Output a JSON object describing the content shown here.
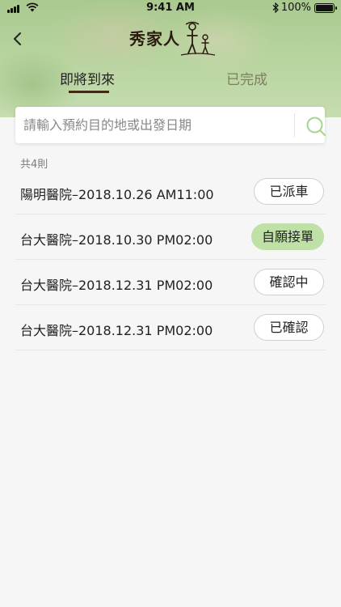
{
  "status_bar": {
    "time": "9:41 AM",
    "battery": "100%"
  },
  "header": {
    "logo_text": "秀家人",
    "back_icon": "chevron-left-icon"
  },
  "tabs": [
    {
      "label": "即將到來",
      "active": true
    },
    {
      "label": "已完成",
      "active": false
    }
  ],
  "search": {
    "placeholder": "請輸入預約目的地或出發日期",
    "value": "",
    "icon": "search-icon"
  },
  "count_label": "共4則",
  "rows": [
    {
      "text": "陽明醫院–2018.10.26 AM11:00",
      "status": "已派車",
      "highlight": false
    },
    {
      "text": "台大醫院–2018.10.30 PM02:00",
      "status": "自願接單",
      "highlight": true
    },
    {
      "text": "台大醫院–2018.12.31 PM02:00",
      "status": "確認中",
      "highlight": false
    },
    {
      "text": "台大醫院–2018.12.31 PM02:00",
      "status": "已確認",
      "highlight": false
    }
  ],
  "colors": {
    "header_green": "#b6d39d",
    "accent_badge": "#bfe0a6",
    "tab_underline": "#3e2b14",
    "search_icon": "#a6d58c"
  }
}
